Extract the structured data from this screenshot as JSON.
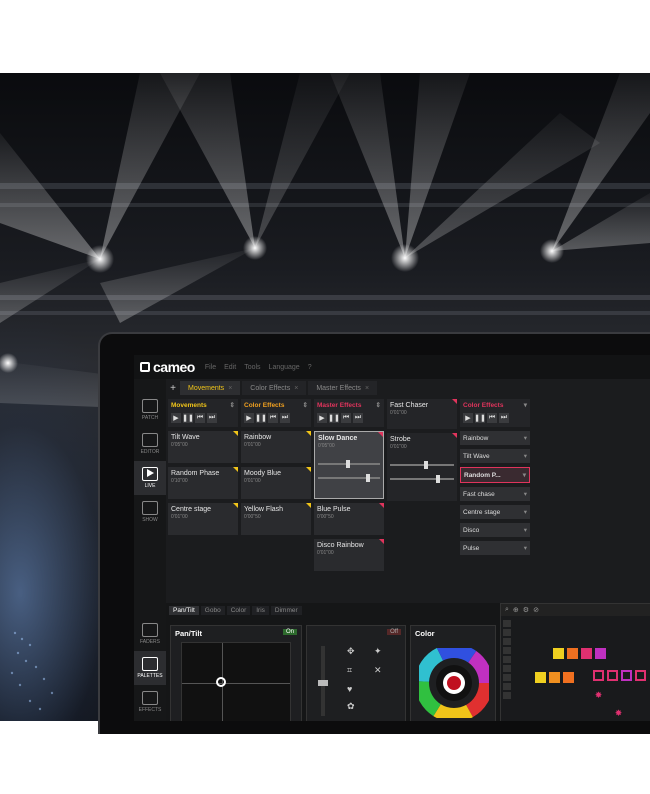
{
  "app": {
    "brand": "cameo",
    "menu": [
      "File",
      "Edit",
      "Tools",
      "Language",
      "?"
    ]
  },
  "sidebar": [
    {
      "label": "PATCH",
      "icon": "patch-icon"
    },
    {
      "label": "EDITOR",
      "icon": "editor-icon"
    },
    {
      "label": "LIVE",
      "icon": "play-icon",
      "active": true
    },
    {
      "label": "SHOW",
      "icon": "show-icon"
    }
  ],
  "sidebar_lower": [
    {
      "label": "FADERS",
      "icon": "faders-icon"
    },
    {
      "label": "PALETTES",
      "icon": "palettes-icon",
      "active": true
    },
    {
      "label": "EFFECTS",
      "icon": "effects-icon"
    }
  ],
  "tabs": [
    {
      "label": "Movements",
      "active": true
    },
    {
      "label": "Color Effects"
    },
    {
      "label": "Master Effects"
    }
  ],
  "columns": [
    {
      "title": "Movements",
      "color": "#f0c419",
      "cues": [
        {
          "name": "Tilt Wave",
          "time": "0'05\"00",
          "flag": "#f0c419"
        },
        {
          "name": "Random Phase",
          "time": "0'10\"00",
          "flag": "#f0c419"
        },
        {
          "name": "Centre stage",
          "time": "0'01\"00",
          "flag": "#f0c419"
        }
      ]
    },
    {
      "title": "Color Effects",
      "color": "#f0a020",
      "cues": [
        {
          "name": "Rainbow",
          "time": "0'01\"00",
          "flag": "#f0c419"
        },
        {
          "name": "Moody Blue",
          "time": "0'01\"00",
          "flag": "#f0c419"
        },
        {
          "name": "Yellow Flash",
          "time": "0'00\"50",
          "flag": "#f0c419"
        }
      ]
    },
    {
      "title": "Master Effects",
      "color": "#e0345c",
      "cues": [
        {
          "name": "Slow Dance",
          "time": "0'05\"00",
          "flag": "#e0345c",
          "selected": true
        },
        {
          "name": "Blue Pulse",
          "time": "0'00\"50",
          "flag": "#e0345c"
        },
        {
          "name": "Disco Rainbow",
          "time": "0'01\"00",
          "flag": "#e0345c"
        }
      ]
    },
    {
      "title": "Fast Chaser",
      "color": "#dddddd",
      "time": "0'01\"00",
      "cues": [
        {
          "name": "Strobe",
          "time": "0'01\"00",
          "flag": "#e0345c"
        }
      ]
    }
  ],
  "palette_column": {
    "title": "Color Effects",
    "items": [
      "Rainbow",
      "Tilt Wave",
      "Random P...",
      "Fast chase",
      "Centre stage",
      "Disco",
      "Pulse"
    ],
    "highlight_index": 2
  },
  "lower": {
    "tabs": [
      "Pan/Tilt",
      "Gobo",
      "Color",
      "Iris",
      "Dimmer"
    ],
    "pantilt_title": "Pan/Tilt",
    "pantilt_toggle": "On",
    "shutter_toggle": "Off",
    "color_title": "Color"
  },
  "colors": {
    "accent_yellow": "#f0c419",
    "accent_pink": "#e0345c"
  }
}
